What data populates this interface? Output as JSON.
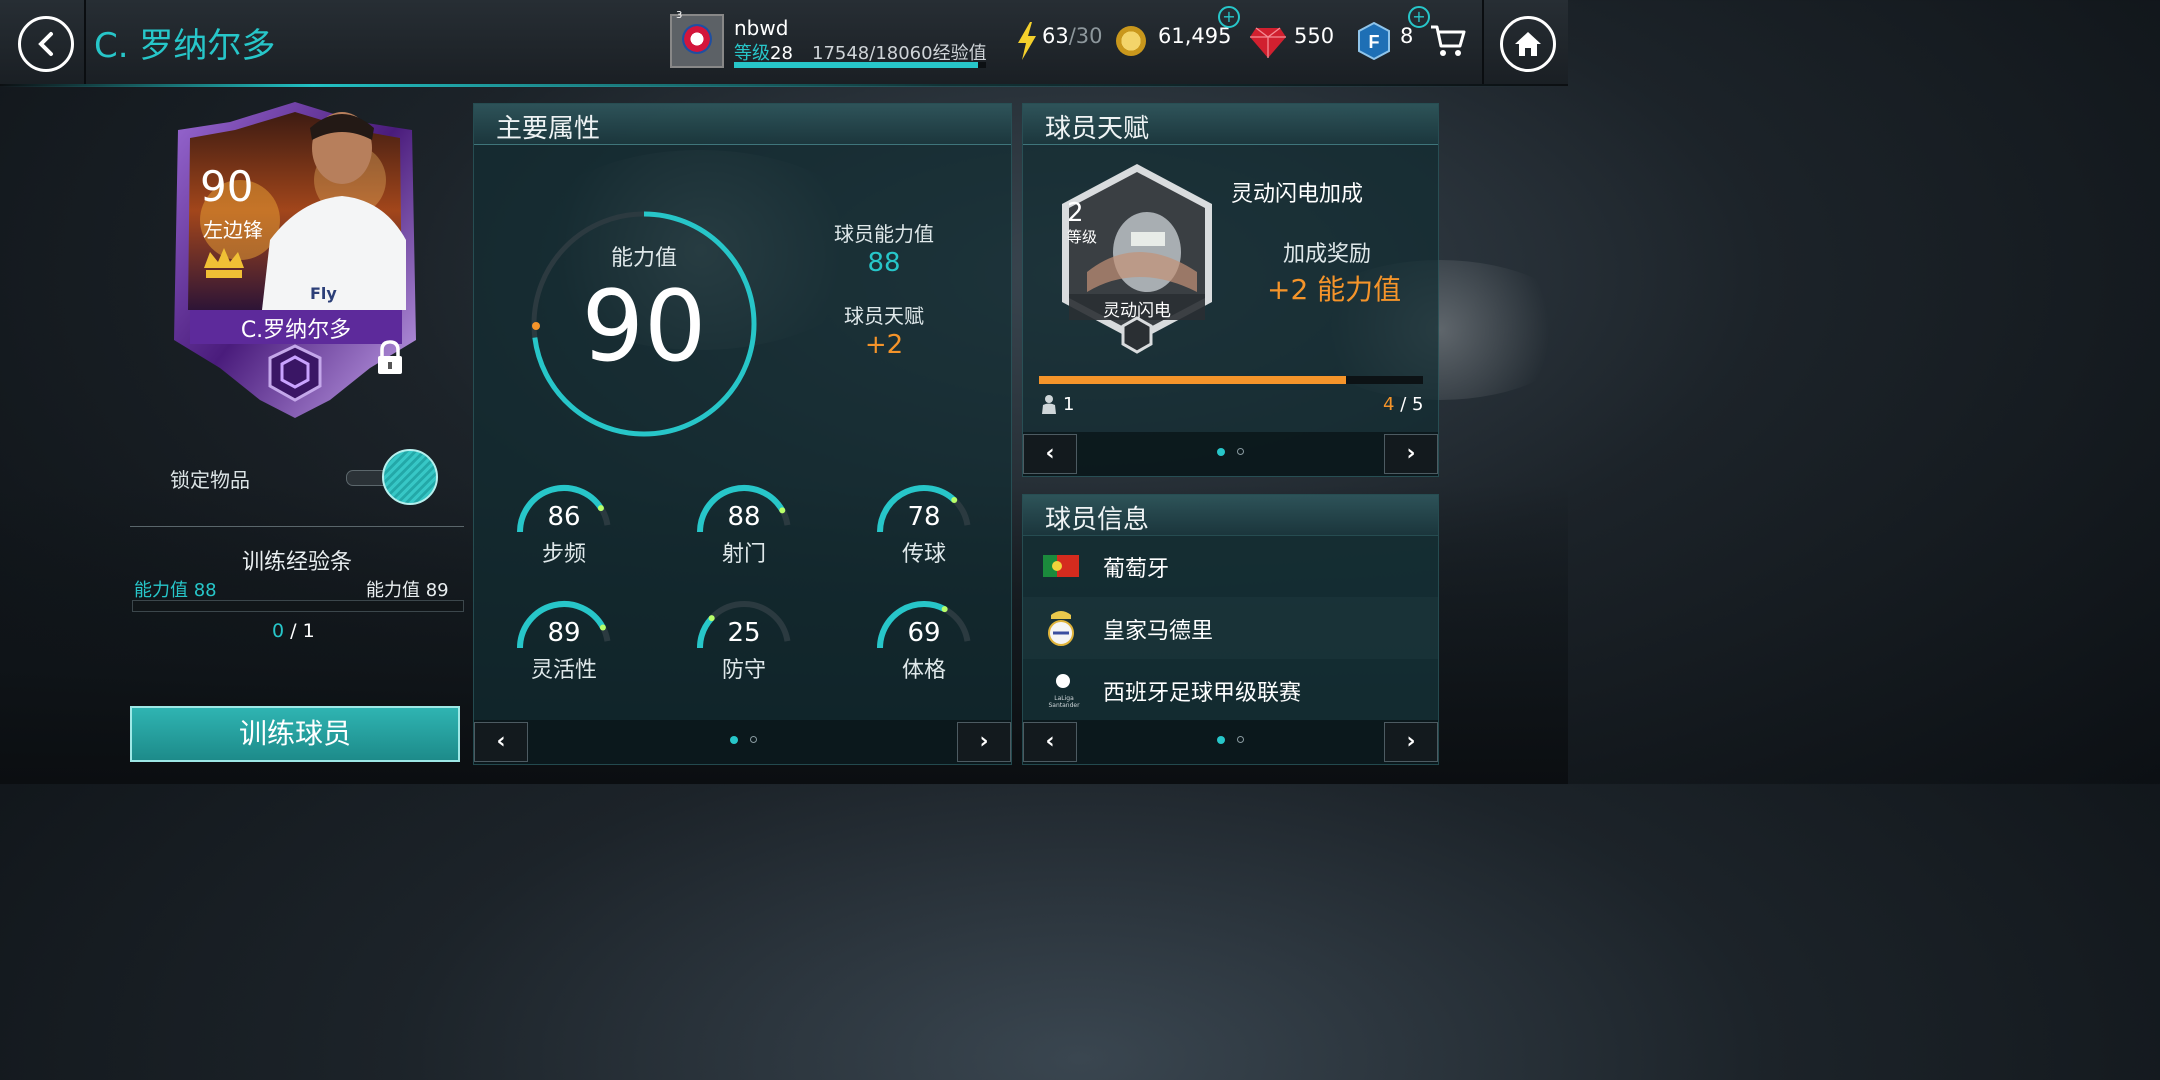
{
  "header": {
    "title": "C. 罗纳尔多",
    "user": {
      "name": "nbwd",
      "level_label": "等级",
      "level": "28",
      "exp_text": "17548/18060经验值",
      "exp_progress": 0.97
    },
    "energy": {
      "current": "63",
      "sep_max": "/30"
    },
    "coins": "61,495",
    "gems": "550",
    "fifa_points": "8"
  },
  "card": {
    "rating": "90",
    "position": "左边锋",
    "name": "C.罗纳尔多",
    "kit_text": "Fly"
  },
  "lock": {
    "label": "锁定物品",
    "enabled": true
  },
  "training": {
    "title": "训练经验条",
    "from_label": "能力值 88",
    "to_label": "能力值",
    "to_value": "89",
    "progress_current": "0",
    "progress_total": "/ 1",
    "button": "训练球员"
  },
  "main_attrs": {
    "title": "主要属性",
    "ovr_label": "能力值",
    "ovr": "90",
    "player_ovr_label": "球员能力值",
    "player_ovr": "88",
    "skill_label": "球员天赋",
    "skill_bonus": "+2",
    "stats": [
      {
        "value": "86",
        "label": "步频",
        "fill": 0.86
      },
      {
        "value": "88",
        "label": "射门",
        "fill": 0.88
      },
      {
        "value": "78",
        "label": "传球",
        "fill": 0.78
      },
      {
        "value": "89",
        "label": "灵活性",
        "fill": 0.89
      },
      {
        "value": "25",
        "label": "防守",
        "fill": 0.25
      },
      {
        "value": "69",
        "label": "体格",
        "fill": 0.69
      }
    ],
    "page": 1,
    "pages": 2
  },
  "skill_panel": {
    "title": "球员天赋",
    "badge_level": "2",
    "badge_level_label": "等级",
    "badge_name": "灵动闪电",
    "skill_name": "灵动闪电加成",
    "bonus_label": "加成奖励",
    "bonus_value": "+2 能力值",
    "bar_progress": 0.8,
    "count": "1",
    "progress_cur": "4",
    "progress_total": "/ 5",
    "page": 1,
    "pages": 2
  },
  "info_panel": {
    "title": "球员信息",
    "nation": "葡萄牙",
    "club": "皇家马德里",
    "league": "西班牙足球甲级联赛",
    "league_logo_text": "LaLiga Santander",
    "page": 1,
    "pages": 2
  },
  "colors": {
    "accent": "#27c6c9",
    "orange": "#f5942a",
    "card_purple": "#6b2fa8"
  }
}
